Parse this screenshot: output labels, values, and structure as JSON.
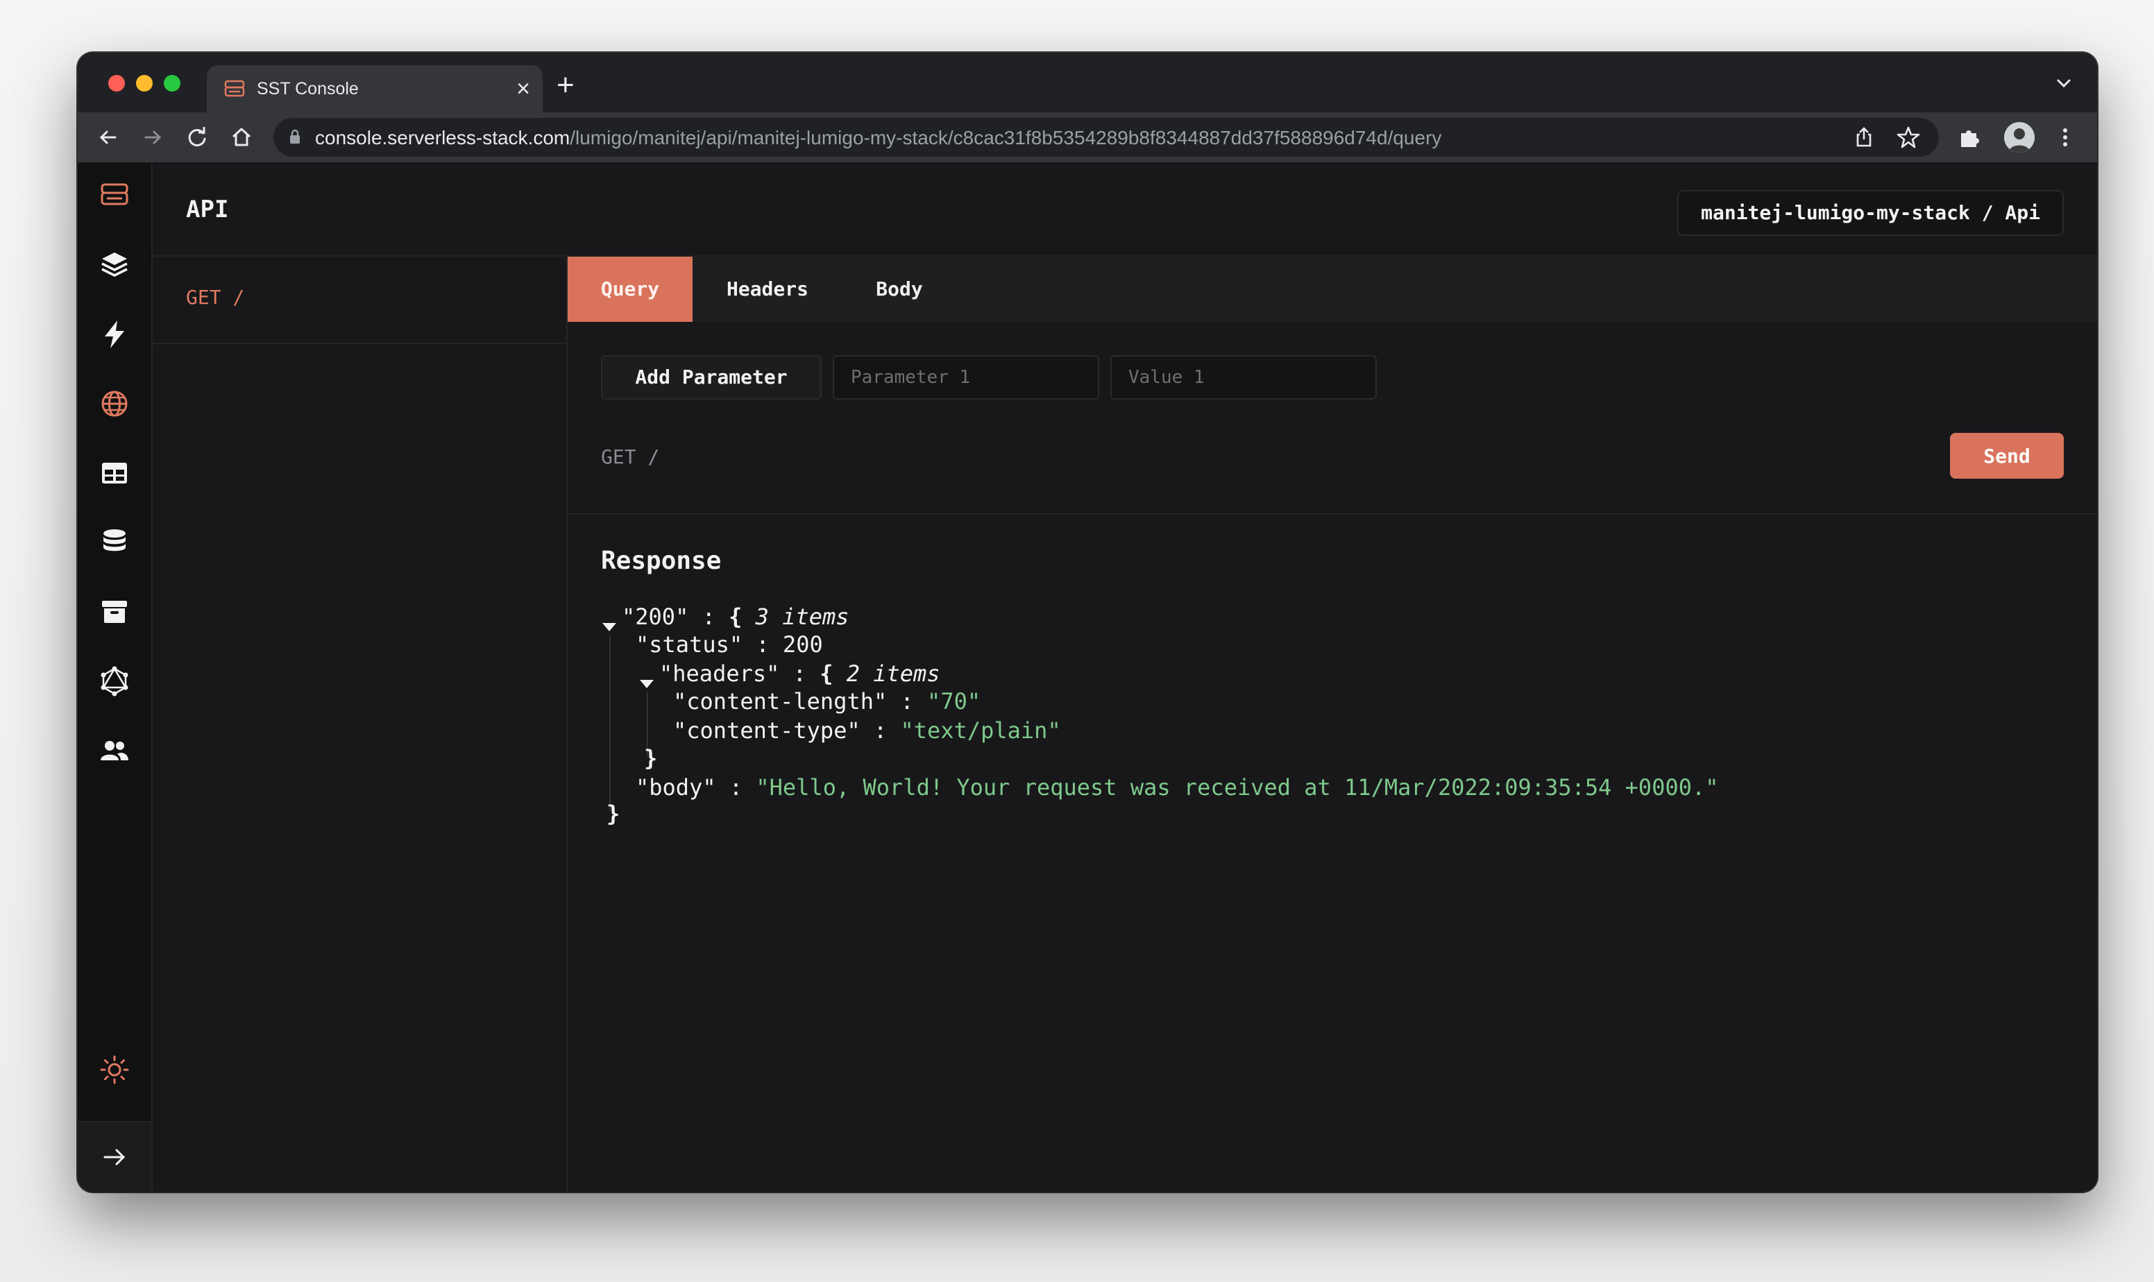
{
  "browser": {
    "tab_title": "SST Console",
    "new_tab_glyph": "+",
    "close_glyph": "×",
    "url_host": "console.serverless-stack.com",
    "url_path": "/lumigo/manitej/api/manitej-lumigo-my-stack/c8cac31f8b5354289b8f8344887dd37f588896d74d/query"
  },
  "app": {
    "page_title": "API",
    "stack_label": "manitej-lumigo-my-stack / Api",
    "accent_color": "#d9735c"
  },
  "sidebar": {
    "icons": [
      "sst-logo-icon",
      "stacks-icon",
      "functions-icon",
      "api-icon",
      "dynamodb-icon",
      "rds-icon",
      "buckets-icon",
      "graphql-icon",
      "cognito-icon",
      "theme-icon",
      "expand-icon"
    ]
  },
  "routes": [
    {
      "label": "GET /"
    }
  ],
  "request": {
    "tabs": [
      "Query",
      "Headers",
      "Body"
    ],
    "active_tab": "Query",
    "add_parameter_label": "Add Parameter",
    "param_placeholder": "Parameter 1",
    "value_placeholder": "Value 1",
    "method_path": "GET /",
    "send_label": "Send"
  },
  "response": {
    "title": "Response",
    "root_key": "\"200\"",
    "root_meta": "3 items",
    "status_key": "\"status\"",
    "status_value": "200",
    "headers_key": "\"headers\"",
    "headers_meta": "2 items",
    "content_length_key": "\"content-length\"",
    "content_length_value": "\"70\"",
    "content_type_key": "\"content-type\"",
    "content_type_value": "\"text/plain\"",
    "body_key": "\"body\"",
    "body_value": "\"Hello, World! Your request was received at 11/Mar/2022:09:35:54 +0000.\"",
    "colon": ":",
    "open_brace": "{",
    "close_brace": "}"
  }
}
